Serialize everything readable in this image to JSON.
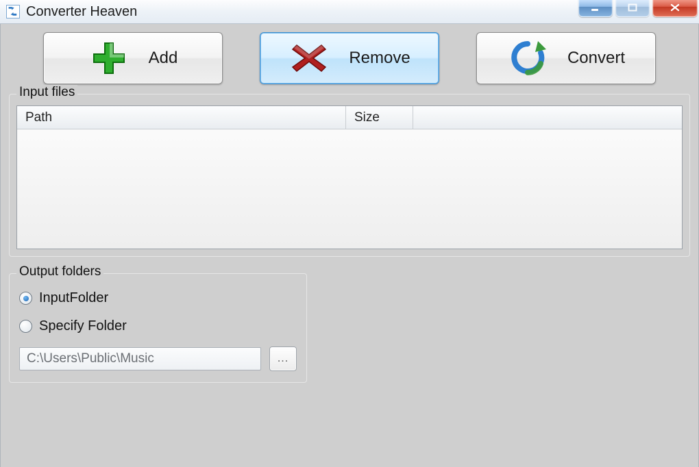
{
  "window": {
    "title": "Converter Heaven"
  },
  "toolbar": {
    "add_label": "Add",
    "remove_label": "Remove",
    "convert_label": "Convert",
    "active_button": "remove"
  },
  "input_files": {
    "legend": "Input files",
    "columns": {
      "path": "Path",
      "size": "Size"
    },
    "rows": []
  },
  "output": {
    "legend": "Output folders",
    "options": {
      "input_folder_label": "InputFolder",
      "specify_folder_label": "Specify Folder"
    },
    "selected": "input_folder",
    "path_value": "C:\\Users\\Public\\Music",
    "browse_label": "..."
  }
}
